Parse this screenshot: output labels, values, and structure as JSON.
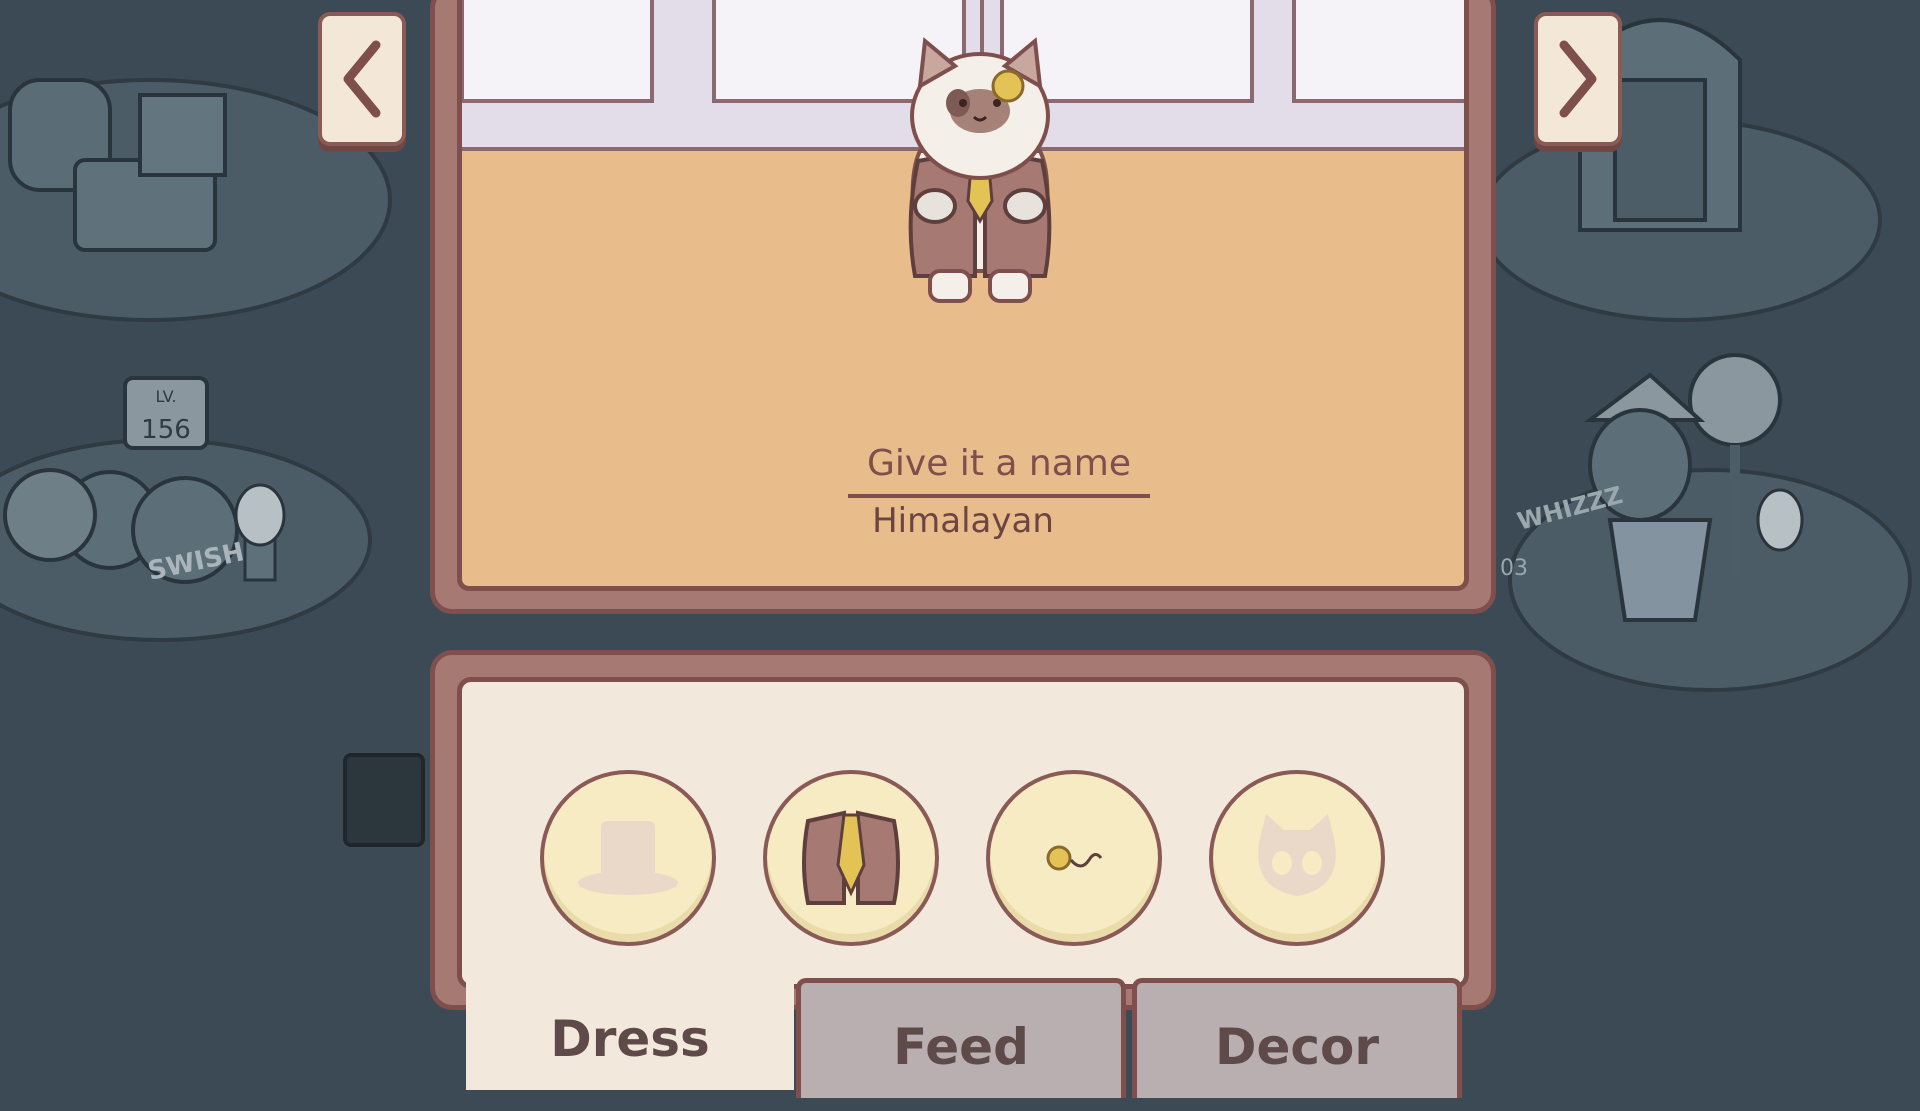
{
  "nav": {
    "prev_icon": "chevron-left-icon",
    "next_icon": "chevron-right-icon"
  },
  "background": {
    "level_sign_label": "LV.",
    "level_sign_value": "156",
    "swish_text": "SWISH",
    "whizz_text": "WHIZZZ",
    "partial_number": "03"
  },
  "pet": {
    "name_placeholder": "Give it a name",
    "breed": "Himalayan"
  },
  "wardrobe": {
    "slots": [
      {
        "name": "hat-slot",
        "icon": "hat-icon",
        "equipped": false
      },
      {
        "name": "outfit-slot",
        "icon": "vest-tie-icon",
        "equipped": true
      },
      {
        "name": "accessory-slot",
        "icon": "monocle-icon",
        "equipped": true
      },
      {
        "name": "skin-slot",
        "icon": "cat-face-icon",
        "equipped": false
      }
    ]
  },
  "tabs": [
    {
      "label": "Dress",
      "active": true
    },
    {
      "label": "Feed",
      "active": false
    },
    {
      "label": "Decor",
      "active": false
    }
  ],
  "colors": {
    "panel_border": "#7e4f4c",
    "room_floor": "#e9bc8c",
    "tab_active": "#f2e9dc",
    "tab_inactive": "#b9afb0"
  }
}
